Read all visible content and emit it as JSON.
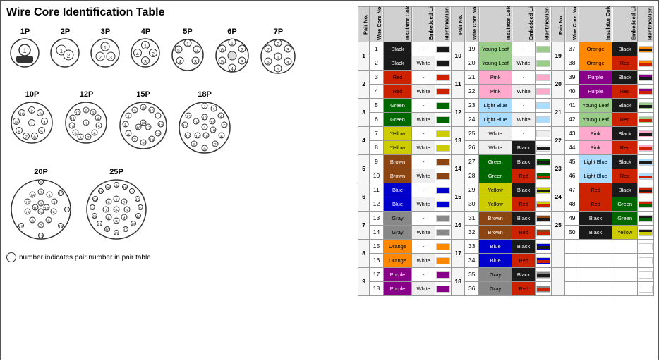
{
  "title": "Wire Core Identification Table",
  "diagrams": [
    {
      "label": "1P",
      "count": 1
    },
    {
      "label": "2P",
      "count": 2
    },
    {
      "label": "3P",
      "count": 3
    },
    {
      "label": "4P",
      "count": 4
    },
    {
      "label": "5P",
      "count": 5
    },
    {
      "label": "6P",
      "count": 6
    },
    {
      "label": "7P",
      "count": 7
    },
    {
      "label": "10P",
      "count": 10
    },
    {
      "label": "12P",
      "count": 12
    },
    {
      "label": "15P",
      "count": 15
    },
    {
      "label": "18P",
      "count": 18
    },
    {
      "label": "20P",
      "count": 20
    },
    {
      "label": "25P",
      "count": 25
    }
  ],
  "note": "number indicates pair number in pair table.",
  "table_headers": [
    "Pair No.",
    "Wire Core No.",
    "Insulator Color",
    "Embedded Line Color",
    "Identification Pattern"
  ],
  "pairs": [
    {
      "pair": 1,
      "wires": [
        {
          "no": 1,
          "ins": "Black",
          "line": "-",
          "ins_color": "#000",
          "line_color": null,
          "pattern": "#1a1a1a"
        },
        {
          "no": 2,
          "ins": "Black",
          "line": "White",
          "ins_color": "#000",
          "line_color": "#fff",
          "pattern": "#1a1a1a"
        }
      ]
    },
    {
      "pair": 2,
      "wires": [
        {
          "no": 3,
          "ins": "Red",
          "line": "-",
          "ins_color": "#e00",
          "line_color": null,
          "pattern": "#cc0000"
        },
        {
          "no": 4,
          "ins": "Red",
          "line": "White",
          "ins_color": "#e00",
          "line_color": "#fff",
          "pattern": "#cc0000"
        }
      ]
    },
    {
      "pair": 3,
      "wires": [
        {
          "no": 5,
          "ins": "Green",
          "line": "-",
          "ins_color": "#080",
          "line_color": null,
          "pattern": "#008800"
        },
        {
          "no": 6,
          "ins": "Green",
          "line": "White",
          "ins_color": "#080",
          "line_color": "#fff",
          "pattern": "#008800"
        }
      ]
    },
    {
      "pair": 4,
      "wires": [
        {
          "no": 7,
          "ins": "Yellow",
          "line": "-",
          "ins_color": "#dd0",
          "line_color": null,
          "pattern": "#cccc00"
        },
        {
          "no": 8,
          "ins": "Yellow",
          "line": "White",
          "ins_color": "#dd0",
          "line_color": "#fff",
          "pattern": "#cccc00"
        }
      ]
    },
    {
      "pair": 5,
      "wires": [
        {
          "no": 9,
          "ins": "Brown",
          "line": "-",
          "ins_color": "#a52",
          "line_color": null,
          "pattern": "#8B4513"
        },
        {
          "no": 10,
          "ins": "Brown",
          "line": "White",
          "ins_color": "#a52",
          "line_color": "#fff",
          "pattern": "#8B4513"
        }
      ]
    },
    {
      "pair": 6,
      "wires": [
        {
          "no": 11,
          "ins": "Blue",
          "line": "-",
          "ins_color": "#00c",
          "line_color": null,
          "pattern": "#0000cc"
        },
        {
          "no": 12,
          "ins": "Blue",
          "line": "White",
          "ins_color": "#00c",
          "line_color": "#fff",
          "pattern": "#0000cc"
        }
      ]
    },
    {
      "pair": 7,
      "wires": [
        {
          "no": 13,
          "ins": "Gray",
          "line": "-",
          "ins_color": "#888",
          "line_color": null,
          "pattern": "#888888"
        },
        {
          "no": 14,
          "ins": "Gray",
          "line": "White",
          "ins_color": "#888",
          "line_color": "#fff",
          "pattern": "#888888"
        }
      ]
    },
    {
      "pair": 8,
      "wires": [
        {
          "no": 15,
          "ins": "Orange",
          "line": "-",
          "ins_color": "#f80",
          "line_color": null,
          "pattern": "#ff8800"
        },
        {
          "no": 16,
          "ins": "Orange",
          "line": "White",
          "ins_color": "#f80",
          "line_color": "#fff",
          "pattern": "#ff8800"
        }
      ]
    },
    {
      "pair": 9,
      "wires": [
        {
          "no": 17,
          "ins": "Purple",
          "line": "-",
          "ins_color": "#808",
          "line_color": null,
          "pattern": "#880088"
        },
        {
          "no": 18,
          "ins": "Purple",
          "line": "White",
          "ins_color": "#808",
          "line_color": "#fff",
          "pattern": "#880088"
        }
      ]
    },
    {
      "pair": 10,
      "wires": [
        {
          "no": 19,
          "ins": "Young Leaf",
          "line": "-",
          "ins_color": "#9dc",
          "line_color": null,
          "pattern": "#aaddaa"
        },
        {
          "no": 20,
          "ins": "Young Leaf",
          "line": "White",
          "ins_color": "#9dc",
          "line_color": "#fff",
          "pattern": "#aaddaa"
        }
      ]
    },
    {
      "pair": 11,
      "wires": [
        {
          "no": 21,
          "ins": "Pink",
          "line": "-",
          "ins_color": "#f9c",
          "line_color": null,
          "pattern": "#ffaacc"
        },
        {
          "no": 22,
          "ins": "Pink",
          "line": "White",
          "ins_color": "#f9c",
          "line_color": "#fff",
          "pattern": "#ffaacc"
        }
      ]
    },
    {
      "pair": 12,
      "wires": [
        {
          "no": 23,
          "ins": "Light Blue",
          "line": "-",
          "ins_color": "#adf",
          "line_color": null,
          "pattern": "#aaddff"
        },
        {
          "no": 24,
          "ins": "Light Blue",
          "line": "White",
          "ins_color": "#adf",
          "line_color": "#fff",
          "pattern": "#aaddff"
        }
      ]
    },
    {
      "pair": 13,
      "wires": [
        {
          "no": 25,
          "ins": "White",
          "line": "-",
          "ins_color": "#eee",
          "line_color": null,
          "pattern": "#eeeeee"
        },
        {
          "no": 26,
          "ins": "White",
          "line": "Black",
          "ins_color": "#eee",
          "line_color": "#000",
          "pattern": "#eeeeee"
        }
      ]
    },
    {
      "pair": 14,
      "wires": [
        {
          "no": 27,
          "ins": "Green",
          "line": "Black",
          "ins_color": "#080",
          "line_color": "#000",
          "pattern": "#008800"
        },
        {
          "no": 28,
          "ins": "Green",
          "line": "Red",
          "ins_color": "#080",
          "line_color": "#e00",
          "pattern": "#008800"
        }
      ]
    },
    {
      "pair": 15,
      "wires": [
        {
          "no": 29,
          "ins": "Yellow",
          "line": "Black",
          "ins_color": "#dd0",
          "line_color": "#000",
          "pattern": "#cccc00"
        },
        {
          "no": 30,
          "ins": "Yellow",
          "line": "Red",
          "ins_color": "#dd0",
          "line_color": "#e00",
          "pattern": "#cccc00"
        }
      ]
    },
    {
      "pair": 16,
      "wires": [
        {
          "no": 31,
          "ins": "Brown",
          "line": "Black",
          "ins_color": "#a52",
          "line_color": "#000",
          "pattern": "#8B4513"
        },
        {
          "no": 32,
          "ins": "Brown",
          "line": "Red",
          "ins_color": "#a52",
          "line_color": "#e00",
          "pattern": "#8B4513"
        }
      ]
    },
    {
      "pair": 17,
      "wires": [
        {
          "no": 33,
          "ins": "Blue",
          "line": "Black",
          "ins_color": "#00c",
          "line_color": "#000",
          "pattern": "#0000cc"
        },
        {
          "no": 34,
          "ins": "Blue",
          "line": "Red",
          "ins_color": "#00c",
          "line_color": "#e00",
          "pattern": "#0000cc"
        }
      ]
    },
    {
      "pair": 18,
      "wires": [
        {
          "no": 35,
          "ins": "Gray",
          "line": "Black",
          "ins_color": "#888",
          "line_color": "#000",
          "pattern": "#888888"
        },
        {
          "no": 36,
          "ins": "Gray",
          "line": "Red",
          "ins_color": "#888",
          "line_color": "#e00",
          "pattern": "#888888"
        }
      ]
    },
    {
      "pair": 19,
      "wires": [
        {
          "no": 37,
          "ins": "Orange",
          "line": "Black",
          "ins_color": "#f80",
          "line_color": "#000",
          "pattern": "#ff8800"
        },
        {
          "no": 38,
          "ins": "Orange",
          "line": "Red",
          "ins_color": "#f80",
          "line_color": "#e00",
          "pattern": "#ff8800"
        }
      ]
    },
    {
      "pair": 20,
      "wires": [
        {
          "no": 39,
          "ins": "Purple",
          "line": "Black",
          "ins_color": "#808",
          "line_color": "#000",
          "pattern": "#880088"
        },
        {
          "no": 40,
          "ins": "Purple",
          "line": "Red",
          "ins_color": "#808",
          "line_color": "#e00",
          "pattern": "#880088"
        }
      ]
    },
    {
      "pair": 21,
      "wires": [
        {
          "no": 41,
          "ins": "Young Leaf",
          "line": "Black",
          "ins_color": "#9dc",
          "line_color": "#000",
          "pattern": "#aaddaa"
        },
        {
          "no": 42,
          "ins": "Young Leaf",
          "line": "Red",
          "ins_color": "#9dc",
          "line_color": "#e00",
          "pattern": "#aaddaa"
        }
      ]
    },
    {
      "pair": 22,
      "wires": [
        {
          "no": 43,
          "ins": "Pink",
          "line": "Black",
          "ins_color": "#f9c",
          "line_color": "#000",
          "pattern": "#ffaacc"
        },
        {
          "no": 44,
          "ins": "Pink",
          "line": "Red",
          "ins_color": "#f9c",
          "line_color": "#e00",
          "pattern": "#ffaacc"
        }
      ]
    },
    {
      "pair": 23,
      "wires": [
        {
          "no": 45,
          "ins": "Light Blue",
          "line": "Black",
          "ins_color": "#adf",
          "line_color": "#000",
          "pattern": "#aaddff"
        },
        {
          "no": 46,
          "ins": "Light Blue",
          "line": "Red",
          "ins_color": "#adf",
          "line_color": "#e00",
          "pattern": "#aaddff"
        }
      ]
    },
    {
      "pair": 24,
      "wires": [
        {
          "no": 47,
          "ins": "Red",
          "line": "Black",
          "ins_color": "#e00",
          "line_color": "#000",
          "pattern": "#cc0000"
        },
        {
          "no": 48,
          "ins": "Red",
          "line": "Green",
          "ins_color": "#e00",
          "line_color": "#080",
          "pattern": "#cc0000"
        }
      ]
    },
    {
      "pair": 25,
      "wires": [
        {
          "no": 49,
          "ins": "Black",
          "line": "Green",
          "ins_color": "#000",
          "line_color": "#080",
          "pattern": "#1a1a1a"
        },
        {
          "no": 50,
          "ins": "Black",
          "line": "Yellow",
          "ins_color": "#000",
          "line_color": "#dd0",
          "pattern": "#1a1a1a"
        }
      ]
    }
  ]
}
